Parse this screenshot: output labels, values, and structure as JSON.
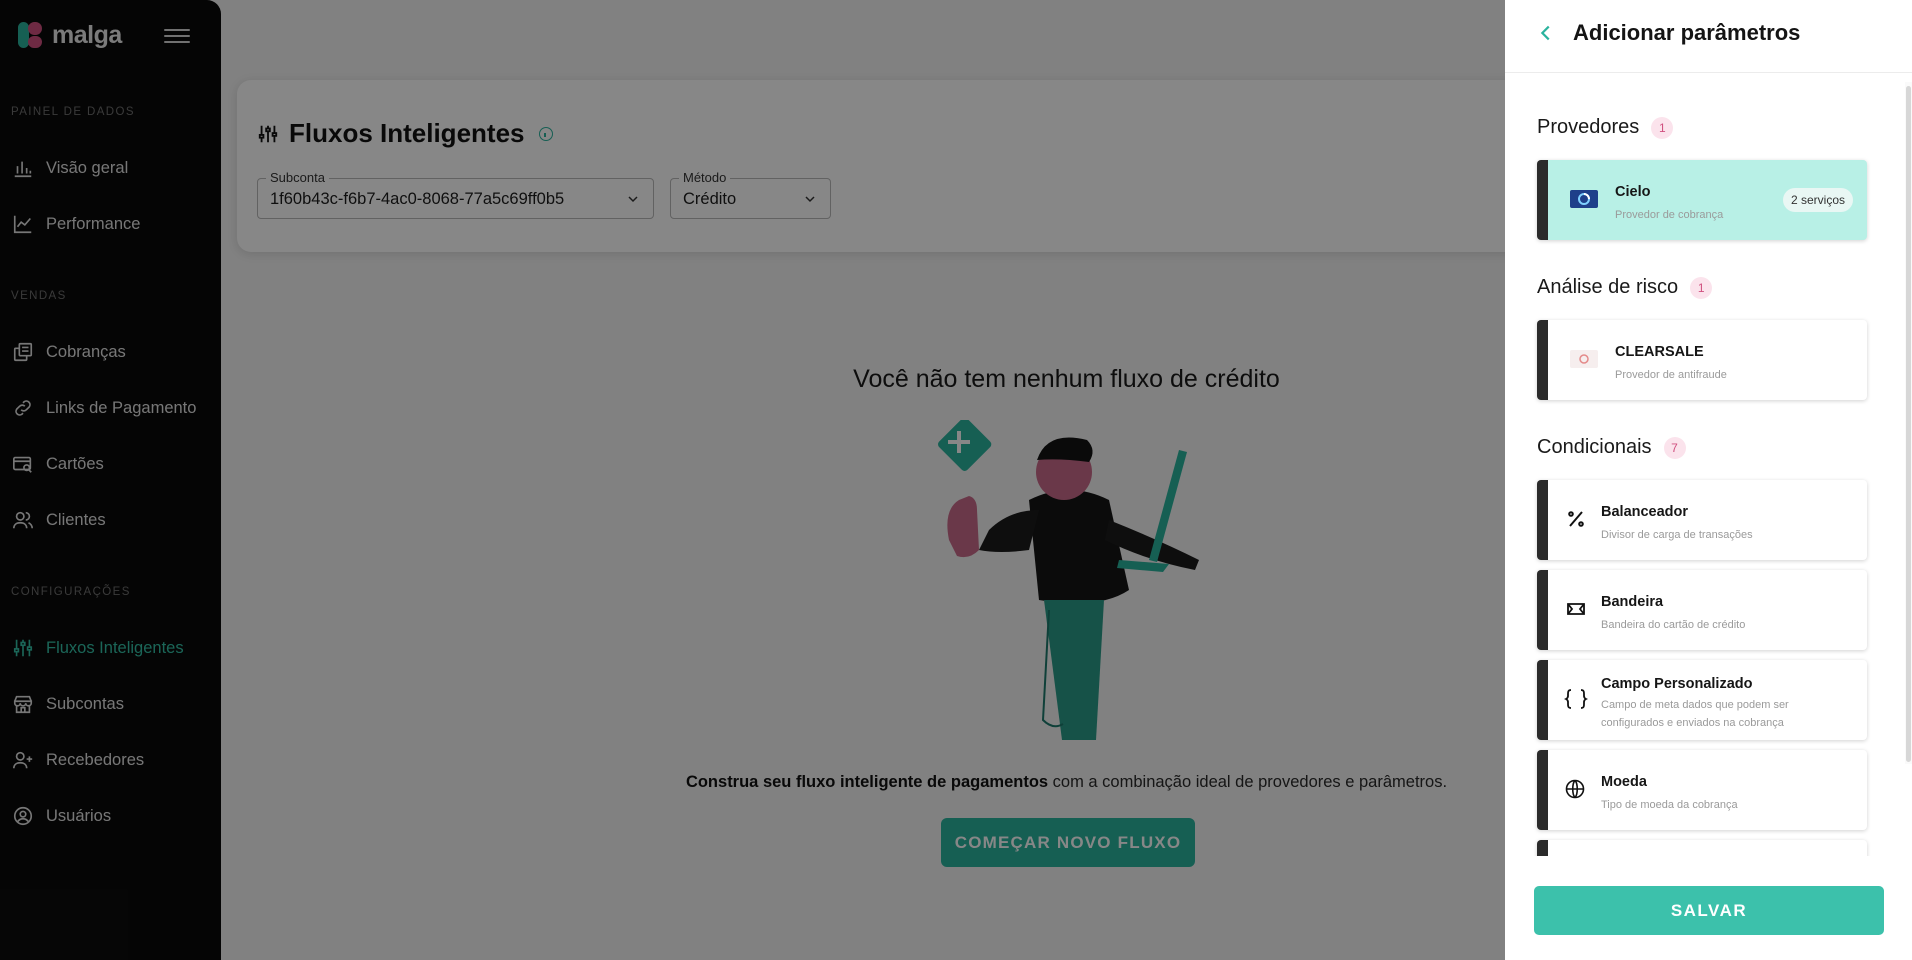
{
  "brand": {
    "name": "malga"
  },
  "sidebar": {
    "sections": [
      {
        "label": "PAINEL DE DADOS",
        "items": [
          {
            "label": "Visão geral"
          },
          {
            "label": "Performance"
          }
        ]
      },
      {
        "label": "VENDAS",
        "items": [
          {
            "label": "Cobranças"
          },
          {
            "label": "Links de Pagamento"
          },
          {
            "label": "Cartões"
          },
          {
            "label": "Clientes"
          }
        ]
      },
      {
        "label": "CONFIGURAÇÕES",
        "items": [
          {
            "label": "Fluxos Inteligentes",
            "active": true
          },
          {
            "label": "Subcontas"
          },
          {
            "label": "Recebedores"
          },
          {
            "label": "Usuários"
          }
        ]
      }
    ]
  },
  "main": {
    "title": "Fluxos Inteligentes",
    "subconta": {
      "label": "Subconta",
      "value": "1f60b43c-f6b7-4ac0-8068-77a5c69ff0b5"
    },
    "metodo": {
      "label": "Método",
      "value": "Crédito"
    },
    "empty_title": "Você não tem nenhum fluxo de crédito",
    "empty_desc_bold": "Construa seu fluxo inteligente de pagamentos",
    "empty_desc_rest": " com a combinação ideal de provedores e parâmetros.",
    "start_button": "COMEÇAR NOVO FLUXO"
  },
  "drawer": {
    "title": "Adicionar parâmetros",
    "provedores": {
      "title": "Provedores",
      "count": "1",
      "items": [
        {
          "title": "Cielo",
          "subtitle": "Provedor de cobrança",
          "badge": "2 serviços",
          "selected": true
        }
      ]
    },
    "risco": {
      "title": "Análise de risco",
      "count": "1",
      "items": [
        {
          "title": "CLEARSALE",
          "subtitle": "Provedor de antifraude"
        }
      ]
    },
    "condicionais": {
      "title": "Condicionais",
      "count": "7",
      "items": [
        {
          "title": "Balanceador",
          "subtitle": "Divisor de carga de transações",
          "icon": "percent-icon"
        },
        {
          "title": "Bandeira",
          "subtitle": "Bandeira do cartão de crédito",
          "icon": "flag-icon"
        },
        {
          "title": "Campo Personalizado",
          "subtitle": "Campo de meta dados que podem ser configurados e enviados na cobrança",
          "icon": "braces-icon"
        },
        {
          "title": "Moeda",
          "subtitle": "Tipo de moeda da cobrança",
          "icon": "globe-icon"
        }
      ]
    },
    "save_button": "SALVAR"
  },
  "colors": {
    "accent": "#2bb39e",
    "brand_pink": "#d0507f",
    "sidebar_bg": "#0b0b0b",
    "selected_card": "#b8f0e6"
  }
}
